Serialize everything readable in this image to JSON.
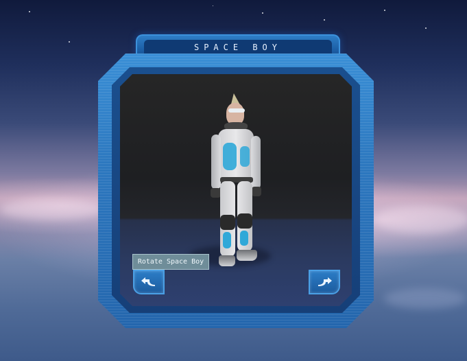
{
  "window": {
    "title": "SPACE BOY"
  },
  "viewport": {
    "tooltip": "Rotate Space Boy"
  },
  "controls": {
    "rotate_left_icon": "rotate-left-arrow",
    "rotate_right_icon": "rotate-right-arrow"
  },
  "colors": {
    "frame_blue": "#2d78bf",
    "frame_border": "#3c92dc",
    "tooltip_bg": "#6f8d99",
    "suit_accent": "#2fa8d8"
  }
}
